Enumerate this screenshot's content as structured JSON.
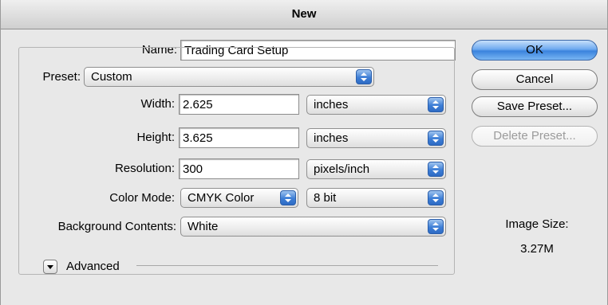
{
  "window": {
    "title": "New"
  },
  "form": {
    "name_label": "Name:",
    "name_value": "Trading Card Setup",
    "preset_label": "Preset:",
    "preset_value": "Custom",
    "width_label": "Width:",
    "width_value": "2.625",
    "width_unit": "inches",
    "height_label": "Height:",
    "height_value": "3.625",
    "height_unit": "inches",
    "resolution_label": "Resolution:",
    "resolution_value": "300",
    "resolution_unit": "pixels/inch",
    "color_mode_label": "Color Mode:",
    "color_mode_value": "CMYK Color",
    "bit_depth_value": "8 bit",
    "background_label": "Background Contents:",
    "background_value": "White",
    "advanced_label": "Advanced"
  },
  "buttons": {
    "ok": "OK",
    "cancel": "Cancel",
    "save_preset": "Save Preset...",
    "delete_preset": "Delete Preset..."
  },
  "image_size": {
    "label": "Image Size:",
    "value": "3.27M"
  },
  "colors": {
    "accent": "#3a83dd",
    "disabled_text": "#9b9b9b"
  },
  "icons": {
    "popup_stepper": "up-down-arrows-icon",
    "disclosure": "disclosure-triangle-down-icon"
  }
}
